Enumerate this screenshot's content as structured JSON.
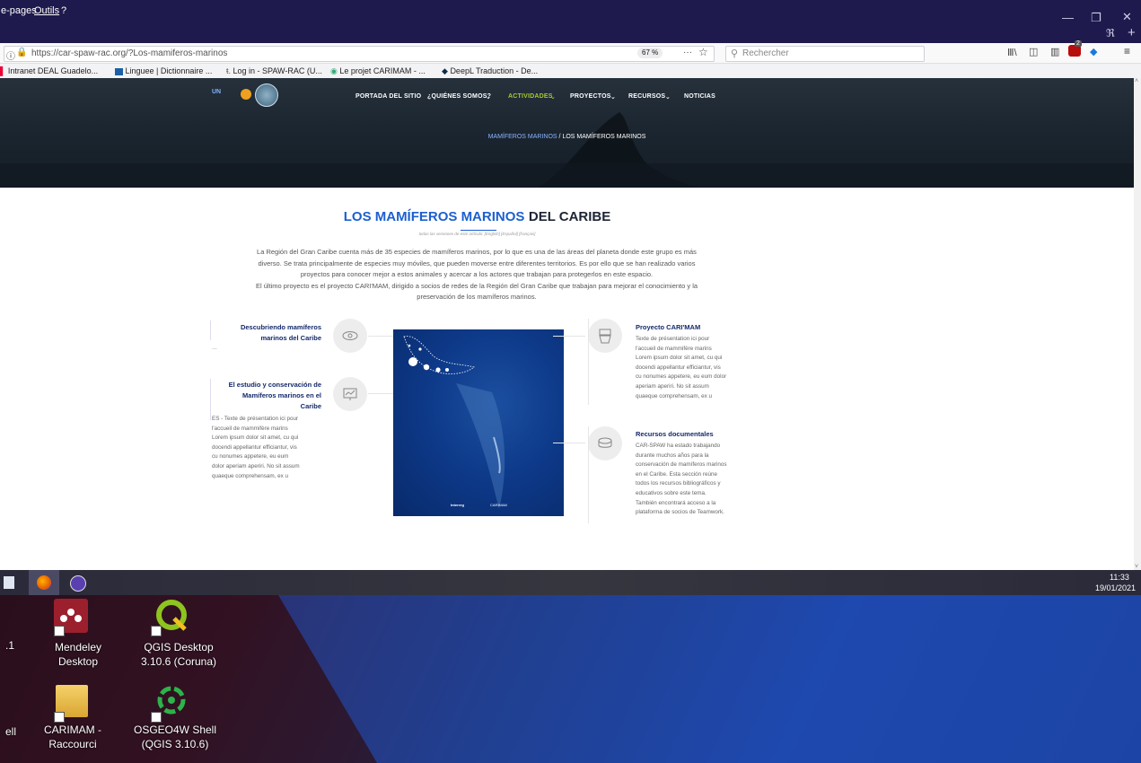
{
  "browser": {
    "menu_items": [
      "e-pages",
      "Outils",
      "?"
    ],
    "url": "https://car-spaw-rac.org/?Los-mamiferos-marinos",
    "zoom": "67 %",
    "more": "···",
    "search_placeholder": "Rechercher",
    "bookmarks": [
      "Intranet DEAL Guadelo...",
      "Linguee | Dictionnaire ...",
      "Log in - SPAW-RAC (U...",
      "Le projet CARIMAM - ...",
      "DeepL Traduction - De..."
    ],
    "extension_badge": "2",
    "accent": "#1e1a4d"
  },
  "site": {
    "logo_text": "UN",
    "nav": [
      "PORTADA DEL SITIO",
      "¿QUIÉNES SOMOS?",
      "ACTIVIDADES",
      "PROYECTOS",
      "RECURSOS",
      "NOTICIAS"
    ],
    "nav_active_color": "#a6c832",
    "breadcrumb_parent": "MAMÍFEROS MARINOS",
    "breadcrumb_sep": "/",
    "breadcrumb_current": "LOS MAMÍFEROS MARINOS",
    "title_blue": "LOS MAMÍFEROS MARINOS",
    "title_dark": "DEL CARIBE",
    "versions_line": "todas las versiones de este artículo: [English] [Español] [français]",
    "intro": [
      "La Región del Gran Caribe cuenta más de 35 especies de mamíferos marinos, por lo que es una de las áreas del planeta donde este grupo es más",
      "diverso. Se trata principalmente de especies muy móviles, que pueden moverse entre diferentes territorios. Es por ello que se han realizado varios",
      "proyectos para conocer mejor a estos animales y acercar a los actores que trabajan para protegerlos en este espacio.",
      "El último proyecto es el proyecto CARI'MAM, dirigido a socios de redes de la Región del Gran Caribe que trabajan para mejorar el conocimiento y la",
      "preservación de los mamíferos marinos."
    ],
    "left_items": [
      {
        "title": [
          "Descubriendo mamíferos",
          "marinos del Caribe"
        ],
        "text": [
          "..."
        ]
      },
      {
        "title": [
          "El estudio y conservación de",
          "Mamíferos marinos en el",
          "Caribe"
        ],
        "text": [
          "ES - Texte de présentation ici pour",
          "l'accueil de mammifère marins",
          "Lorem ipsum dolor sit amet, cu qui",
          "docendi appellantur efficiantur, vis",
          "cu nonumes appetere, eu eum",
          "dolor aperiam aperiri. No sit assum",
          "quaeque comprehensam, ex u"
        ]
      }
    ],
    "right_items": [
      {
        "title": "Proyecto CARI'MAM",
        "text": [
          "Texte de présentation ici pour",
          "l'accueil de mammifère marins",
          "Lorem ipsum dolor sit amet, cu qui",
          "docendi appellantur efficiantur, vis",
          "cu nonumes appetere, eu eum dolor",
          "aperiam aperiri. No sit assum",
          "quaeque comprehensam, ex u"
        ]
      },
      {
        "title": "Recursos documentales",
        "text": [
          "CAR-SPAW ha estado trabajando",
          "durante muchos años para la",
          "conservación de mamíferos marinos",
          "en el Caribe. Esta sección reúne",
          "todos los recursos bibliográficos y",
          "educativos sobre este tema.",
          "También encontrará acceso a la",
          "plataforma de socios de Teamwork."
        ]
      }
    ],
    "poster_logos": [
      "Interreg",
      "CARIMAM"
    ]
  },
  "taskbar": {
    "time": "11:33",
    "date": "19/01/2021"
  },
  "desktop_icons": [
    {
      "label": [
        "Mendeley",
        "Desktop"
      ],
      "icon": "mendeley-icon"
    },
    {
      "label": [
        "QGIS Desktop",
        "3.10.6 (Coruna)"
      ],
      "icon": "qgis-icon"
    },
    {
      "label": [
        "CARIMAM -",
        "Raccourci"
      ],
      "icon": "folder-icon"
    },
    {
      "label": [
        "OSGEO4W Shell",
        "(QGIS 3.10.6)"
      ],
      "icon": "osgeo-icon"
    }
  ],
  "desktop_partial_labels": [
    ".1",
    "ell"
  ]
}
